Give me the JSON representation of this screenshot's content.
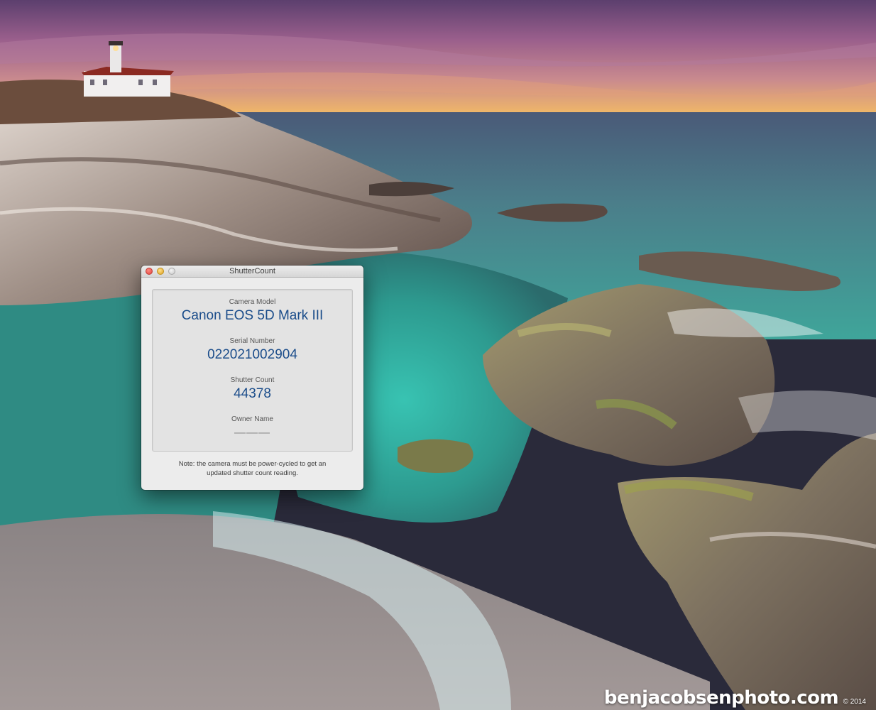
{
  "window": {
    "title": "ShutterCount"
  },
  "fields": {
    "camera_model_label": "Camera Model",
    "camera_model_value": "Canon EOS 5D Mark III",
    "serial_label": "Serial Number",
    "serial_value": "022021002904",
    "shutter_label": "Shutter Count",
    "shutter_value": "44378",
    "owner_label": "Owner Name",
    "owner_value": "———"
  },
  "note": {
    "line1": "Note: the camera must be power-cycled to get an",
    "line2": "updated shutter count reading."
  },
  "watermark": {
    "site": "benjacobsenphoto.com",
    "copyright": "© 2014"
  },
  "colors": {
    "value_text": "#1a4c8a",
    "window_bg": "#ececec",
    "panel_bg": "#e3e3e3"
  },
  "icons": {
    "close": "close-button",
    "minimize": "minimize-button",
    "zoom": "zoom-button"
  }
}
